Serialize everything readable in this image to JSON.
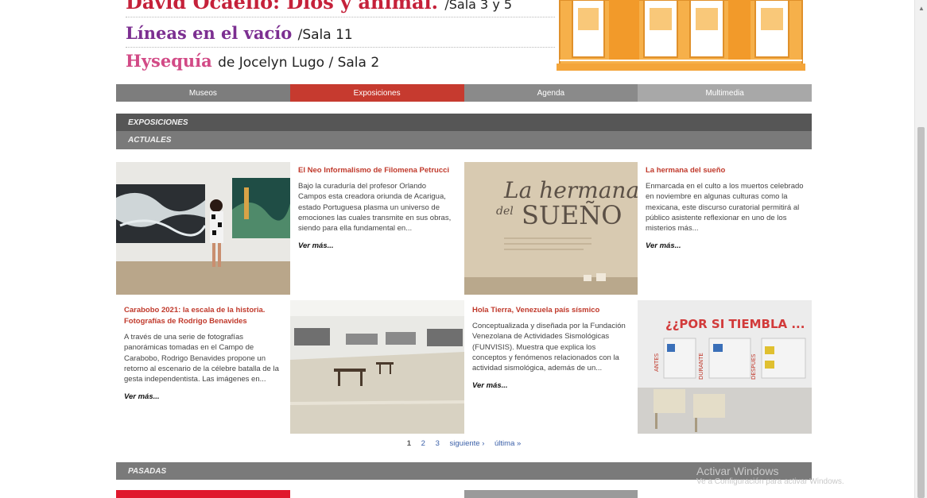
{
  "banner": {
    "line1_title": "David Ocaello: Dios y animal.",
    "line1_sub": "/Sala 3 y 5",
    "line2_title": "Líneas en el vacío",
    "line2_sub": "/Sala 11",
    "line3_title": "Hysequía",
    "line3_sub": "de Jocelyn Lugo / Sala 2"
  },
  "nav": {
    "museos": "Museos",
    "exposiciones": "Exposiciones",
    "agenda": "Agenda",
    "multimedia": "Multimedia"
  },
  "sections": {
    "exposiciones": "EXPOSICIONES",
    "actuales": "ACTUALES",
    "pasadas": "PASADAS"
  },
  "exhibitions": [
    {
      "title": "El Neo Informalismo de Filomena Petrucci",
      "description": "Bajo la curaduría del profesor Orlando Campos esta creadora oriunda de Acarigua, estado Portuguesa plasma un universo de emociones las cuales transmite en sus obras, siendo para ella fundamental en...",
      "more": "Ver más..."
    },
    {
      "title": "La hermana del sueño",
      "description": "Enmarcada en el culto a los muertos celebrado en noviembre en algunas culturas como la mexicana, este discurso curatorial permitirá al público asistente reflexionar en uno de los misterios más...",
      "more": "Ver más...",
      "image_text_1": "La hermana",
      "image_text_2": "del",
      "image_text_3": "SUEÑO"
    },
    {
      "title": "Carabobo 2021: la escala de la historia. Fotografías de Rodrigo Benavides",
      "description": "A través de una serie de fotografías panorámicas tomadas en el Campo de Carabobo, Rodrigo Benavides propone un retorno al escenario de la célebre batalla de la gesta independentista. Las imágenes en...",
      "more": "Ver más..."
    },
    {
      "title": "Hola Tierra, Venezuela país sísmico",
      "description": "Conceptualizada y diseñada por la Fundación Venezolana de Actividades Sismológicas (FUNVISIS). Muestra que explica los conceptos y fenómenos relacionados con la actividad sismológica, además de un...",
      "more": "Ver más...",
      "image_text": "¿¿POR SI TIEMBLA ...",
      "image_labels": [
        "ANTES",
        "DURANTE",
        "DESPUÉS"
      ]
    }
  ],
  "pager": {
    "current": "1",
    "page2": "2",
    "page3": "3",
    "next": "siguiente ›",
    "last": "última »"
  },
  "watermark": {
    "title": "Activar Windows",
    "subtitle": "Ve a Configuración para activar Windows."
  },
  "colors": {
    "accent_red": "#c63a2f",
    "title_red": "#c0392b",
    "dark_bar": "#565656",
    "mid_bar": "#7a7a7a",
    "building_orange": "#f4a53a"
  }
}
